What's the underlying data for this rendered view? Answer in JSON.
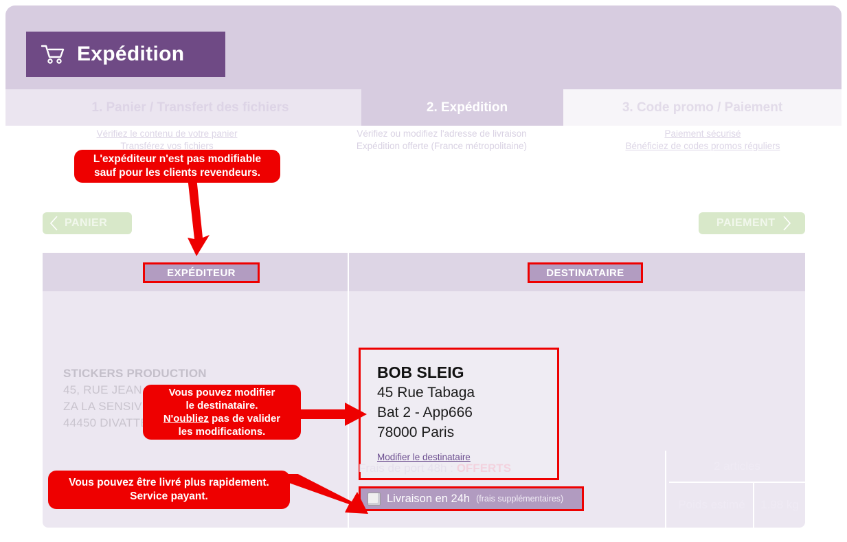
{
  "header": {
    "title": "Expédition",
    "icon": "shopping-cart-icon"
  },
  "steps": [
    {
      "label": "1. Panier / Transfert des fichiers",
      "notes": [
        "Vérifiez le contenu de votre panier",
        "Transférez vos fichiers"
      ]
    },
    {
      "label": "2. Expédition",
      "notes": [
        "Vérifiez ou modifiez l'adresse de livraison",
        "Expédition offerte (France métropolitaine)"
      ]
    },
    {
      "label": "3. Code promo / Paiement",
      "notes": [
        "Paiement sécurisé",
        "Bénéficiez de codes promos réguliers"
      ]
    }
  ],
  "nav": {
    "back_label": "PANIER",
    "next_label": "PAIEMENT"
  },
  "table": {
    "sender_header": "EXPÉDITEUR",
    "recipient_header": "DESTINATAIRE",
    "sender": {
      "name": "STICKERS PRODUCTION",
      "lines": [
        "45, RUE JEAN MONNET",
        "ZA LA SENSIVE",
        "44450 DIVATTE SUR LOIRE"
      ]
    },
    "recipient": {
      "name": "BOB SLEIG",
      "line1": "45 Rue Tabaga",
      "line2": "Bat 2 - App666",
      "line3": "78000 Paris",
      "edit_link": "Modifier le destinataire"
    },
    "shipping": {
      "fee_label": "Frais de port 48h :",
      "fee_value": "OFFERTS",
      "express_label": "Livraison en 24h",
      "express_note": "(frais supplémentaires)",
      "express_checked": false
    },
    "summary": {
      "articles": "2 articles",
      "weight_label": "Poids estimé",
      "weight_value": "1.98 kg"
    }
  },
  "annotations": [
    {
      "id": "sender-not-editable",
      "line1": "L'expéditeur n'est pas modifiable",
      "line2": "sauf pour les clients revendeurs."
    },
    {
      "id": "edit-recipient",
      "line1": "Vous pouvez modifier",
      "line2": "le destinataire.",
      "line3_underlined": "N'oubliez",
      "line3_rest": " pas de valider",
      "line4": "les modifications."
    },
    {
      "id": "faster-delivery",
      "line1": "Vous pouvez être livré plus rapidement.",
      "line2": "Service payant."
    }
  ],
  "colors": {
    "brand_purple": "#6f4a85",
    "band_lavender": "#d7cce0",
    "annotation_red": "#ee0000",
    "nav_green": "#d8e8c9"
  }
}
